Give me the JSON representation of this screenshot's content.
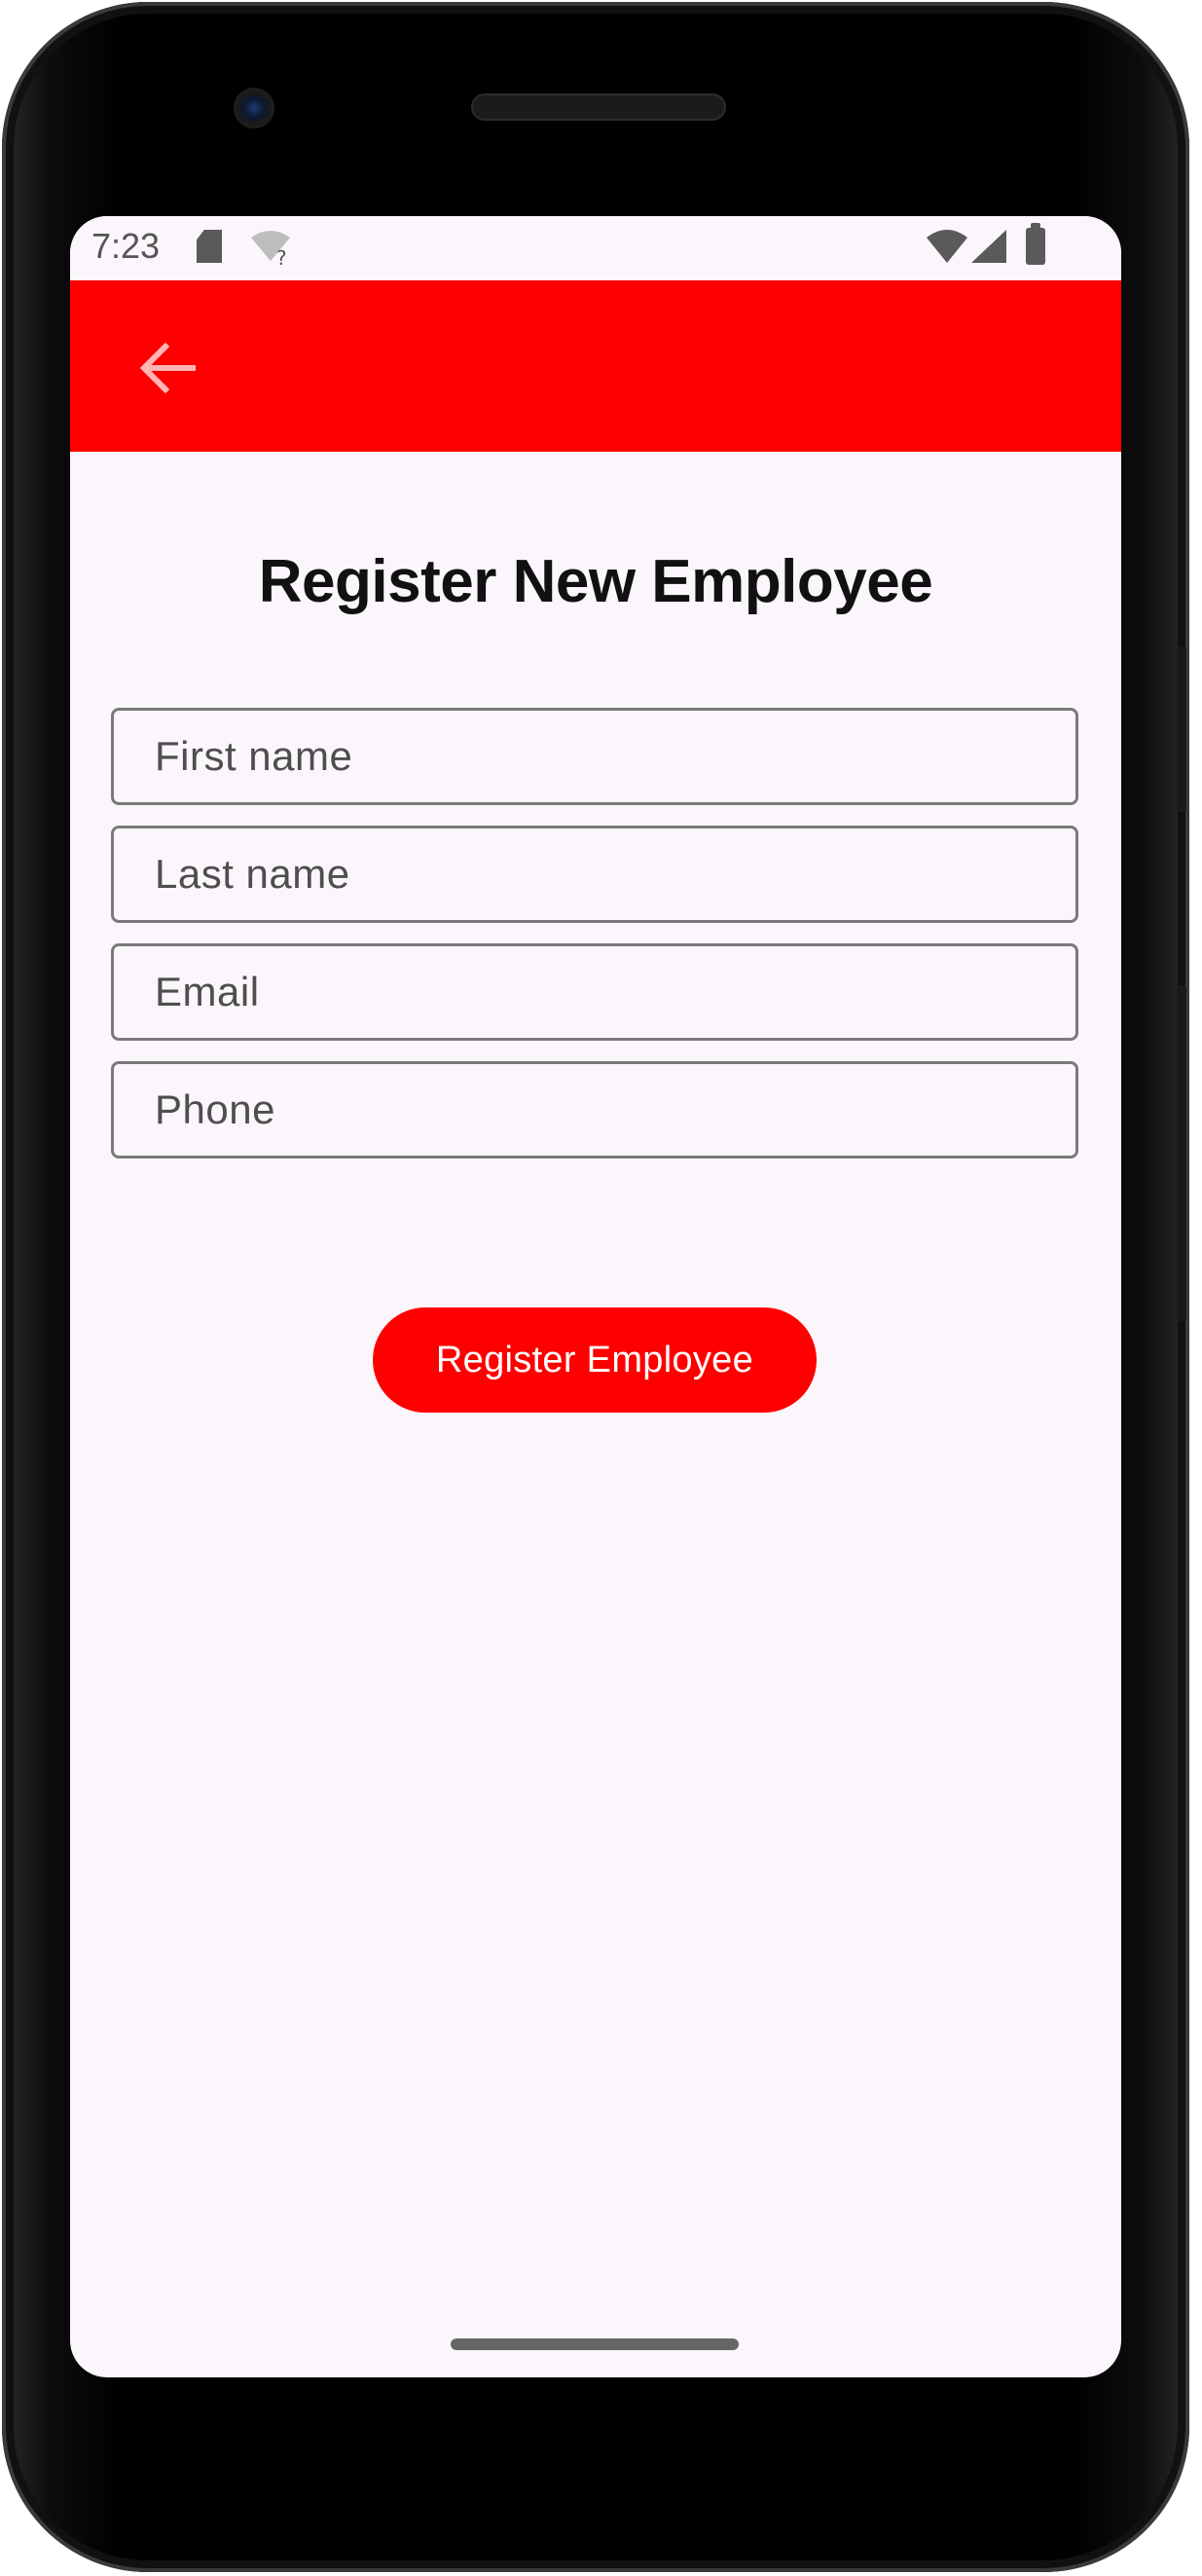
{
  "status_bar": {
    "time": "7:23",
    "icons": [
      "sd-card-icon",
      "wifi-unknown-icon",
      "wifi-icon",
      "signal-icon",
      "battery-icon"
    ]
  },
  "app_bar": {
    "color": "#ff0000",
    "back_icon": "arrow-left-icon"
  },
  "main": {
    "title": "Register New Employee",
    "fields": {
      "first_name": {
        "placeholder": "First name",
        "value": ""
      },
      "last_name": {
        "placeholder": "Last name",
        "value": ""
      },
      "email": {
        "placeholder": "Email",
        "value": ""
      },
      "phone": {
        "placeholder": "Phone",
        "value": ""
      }
    },
    "submit_label": "Register Employee",
    "accent_color": "#ff0000",
    "background_color": "#fbf6fb"
  }
}
